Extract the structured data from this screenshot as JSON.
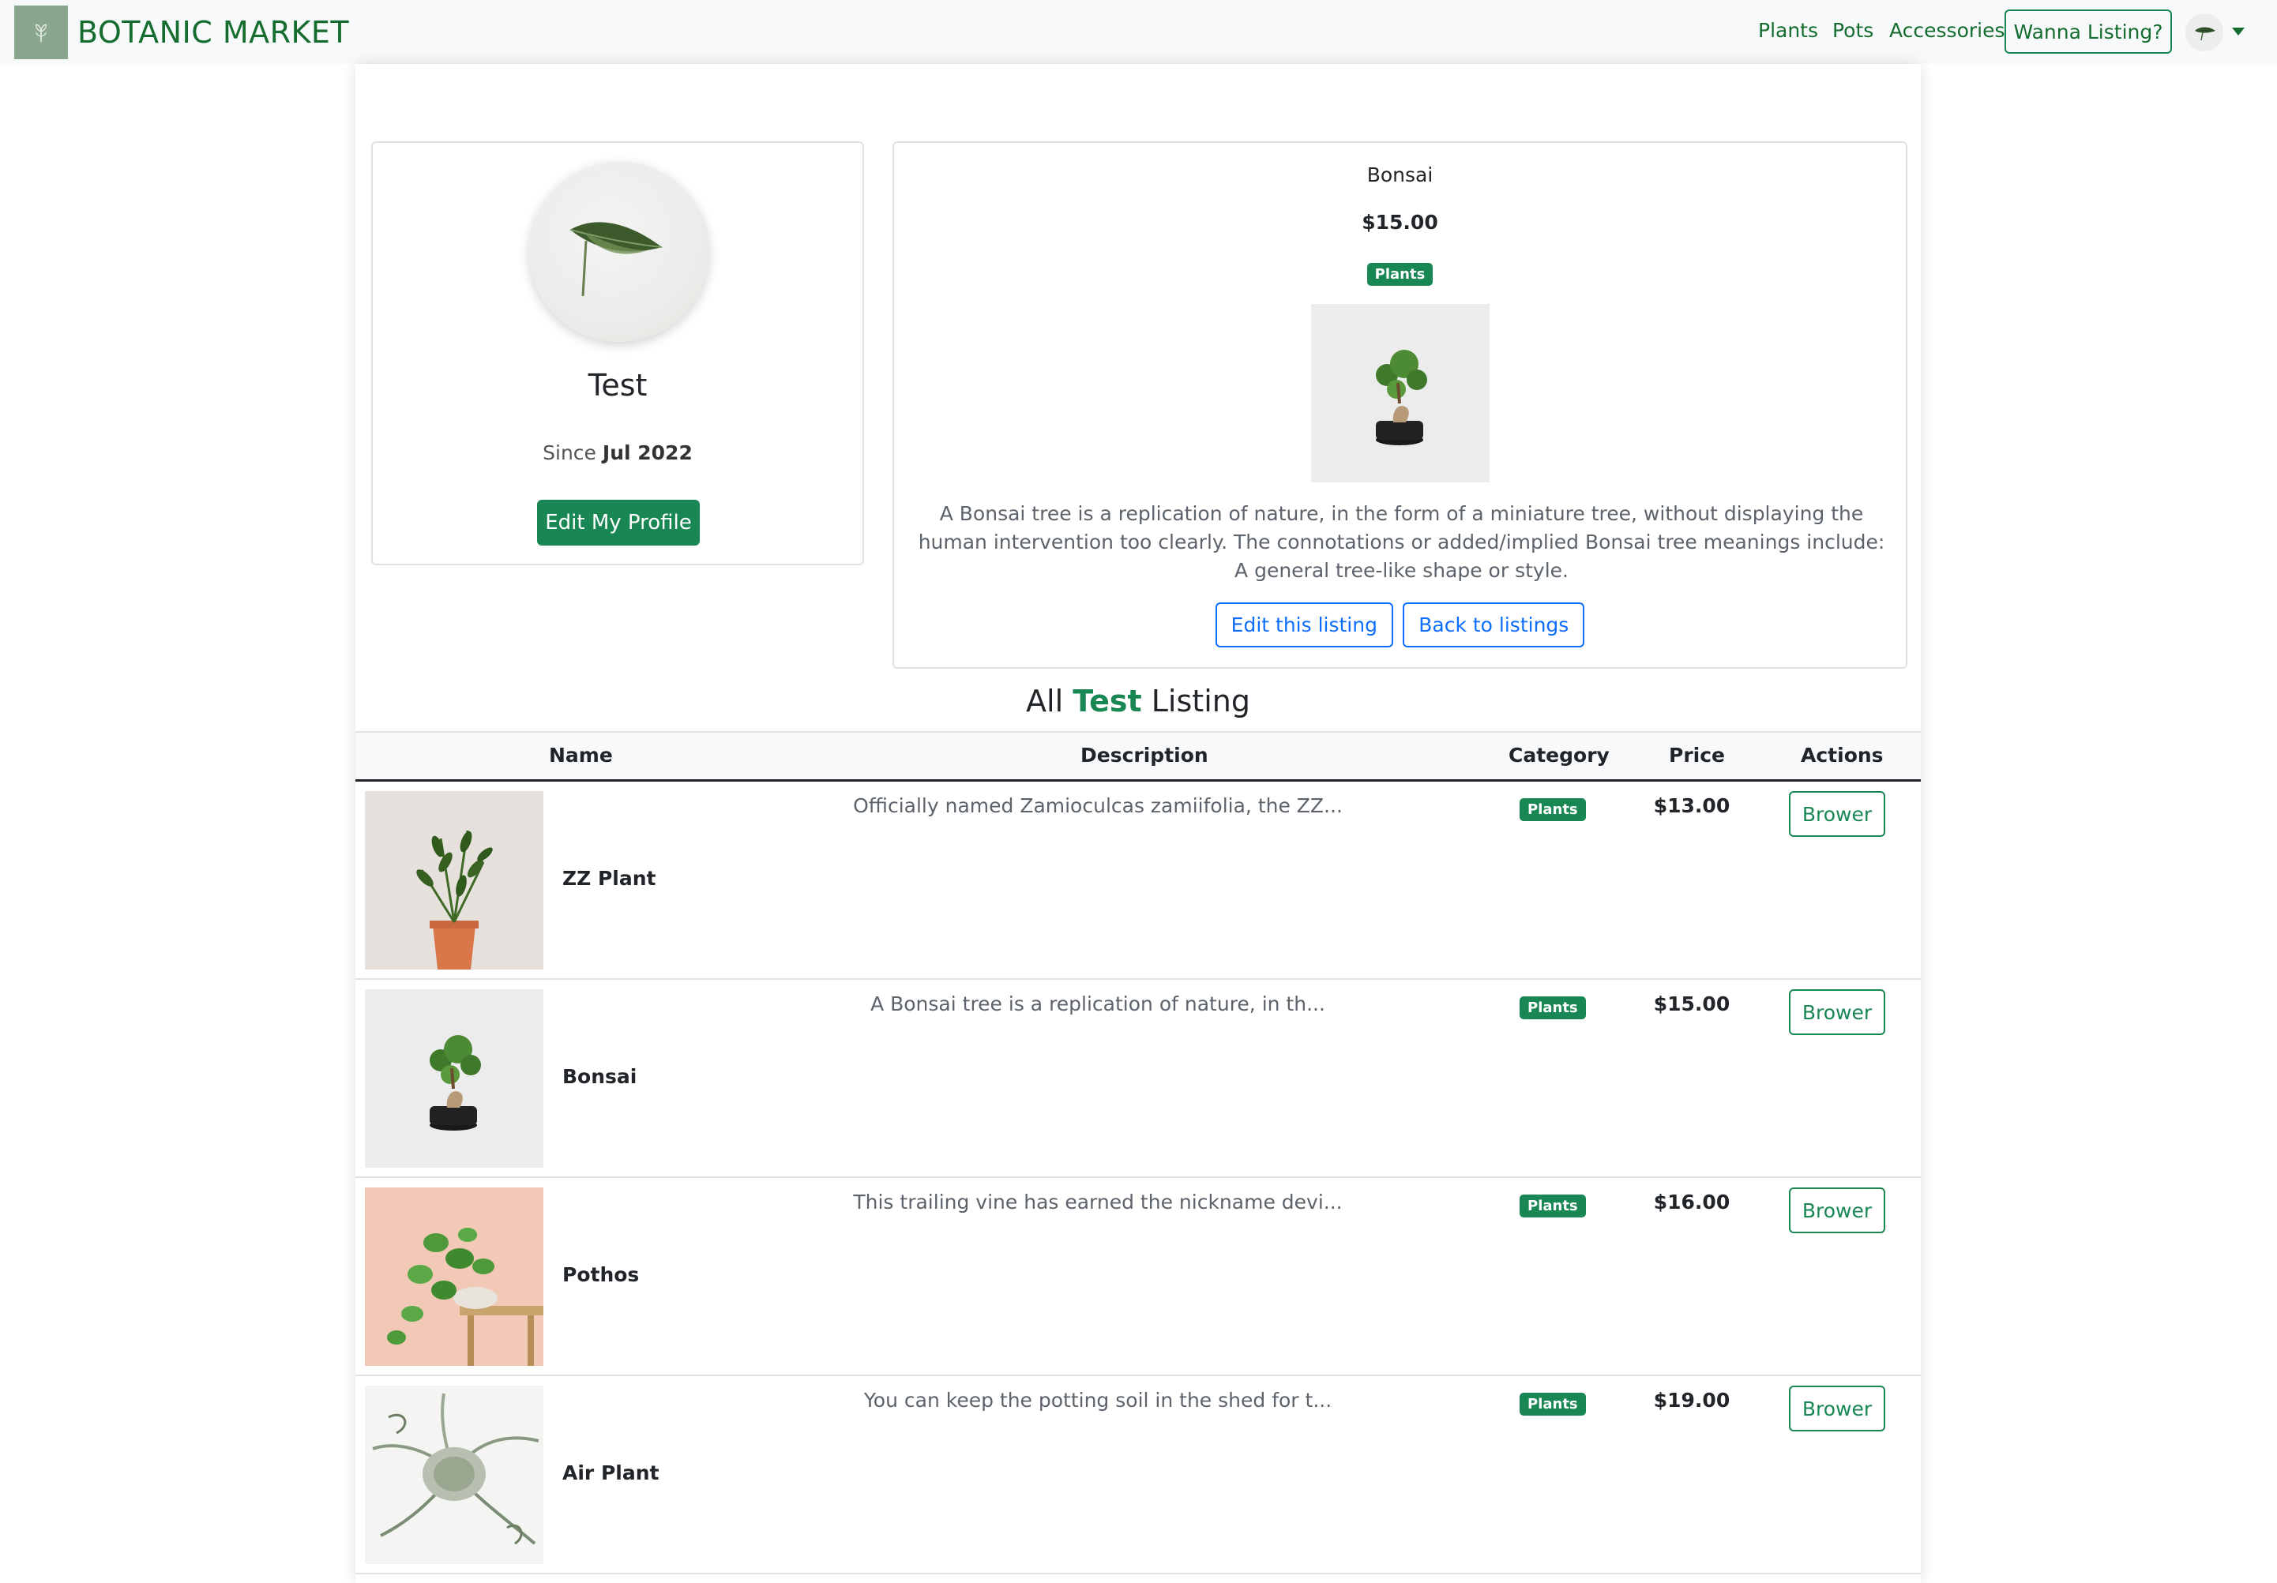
{
  "navbar": {
    "brand": "BOTANIC MARKET",
    "links": [
      "Plants",
      "Pots",
      "Accessories"
    ],
    "cta": "Wanna Listing?",
    "logo_icon": "sprout-icon",
    "avatar_icon": "leaf-avatar"
  },
  "profile": {
    "name": "Test",
    "since_prefix": "Since",
    "since_date": "Jul 2022",
    "edit_button": "Edit My Profile"
  },
  "listing": {
    "title": "Bonsai",
    "price": "$15.00",
    "category": "Plants",
    "description": "A Bonsai tree is a replication of nature, in the form of a miniature tree, without displaying the human intervention too clearly. The connotations or added/implied Bonsai tree meanings include: A general tree-like shape or style.",
    "edit_button": "Edit this listing",
    "back_button": "Back to listings"
  },
  "all_listing": {
    "prefix": "All",
    "user": "Test",
    "suffix": "Listing"
  },
  "table": {
    "headers": [
      "Name",
      "Description",
      "Category",
      "Price",
      "Actions"
    ],
    "rows": [
      {
        "name": "ZZ Plant",
        "description": "Officially named Zamioculcas zamiifolia, the ZZ...",
        "category": "Plants",
        "price": "$13.00",
        "action": "Brower"
      },
      {
        "name": "Bonsai",
        "description": "A Bonsai tree is a replication of nature, in th...",
        "category": "Plants",
        "price": "$15.00",
        "action": "Brower"
      },
      {
        "name": "Pothos",
        "description": "This trailing vine has earned the nickname devi...",
        "category": "Plants",
        "price": "$16.00",
        "action": "Brower"
      },
      {
        "name": "Air Plant",
        "description": "You can keep the potting soil in the shed for t...",
        "category": "Plants",
        "price": "$19.00",
        "action": "Brower"
      }
    ]
  },
  "colors": {
    "brand_green": "#198754",
    "link_blue": "#0d6efd",
    "navbar_bg": "#f8f9fa"
  }
}
